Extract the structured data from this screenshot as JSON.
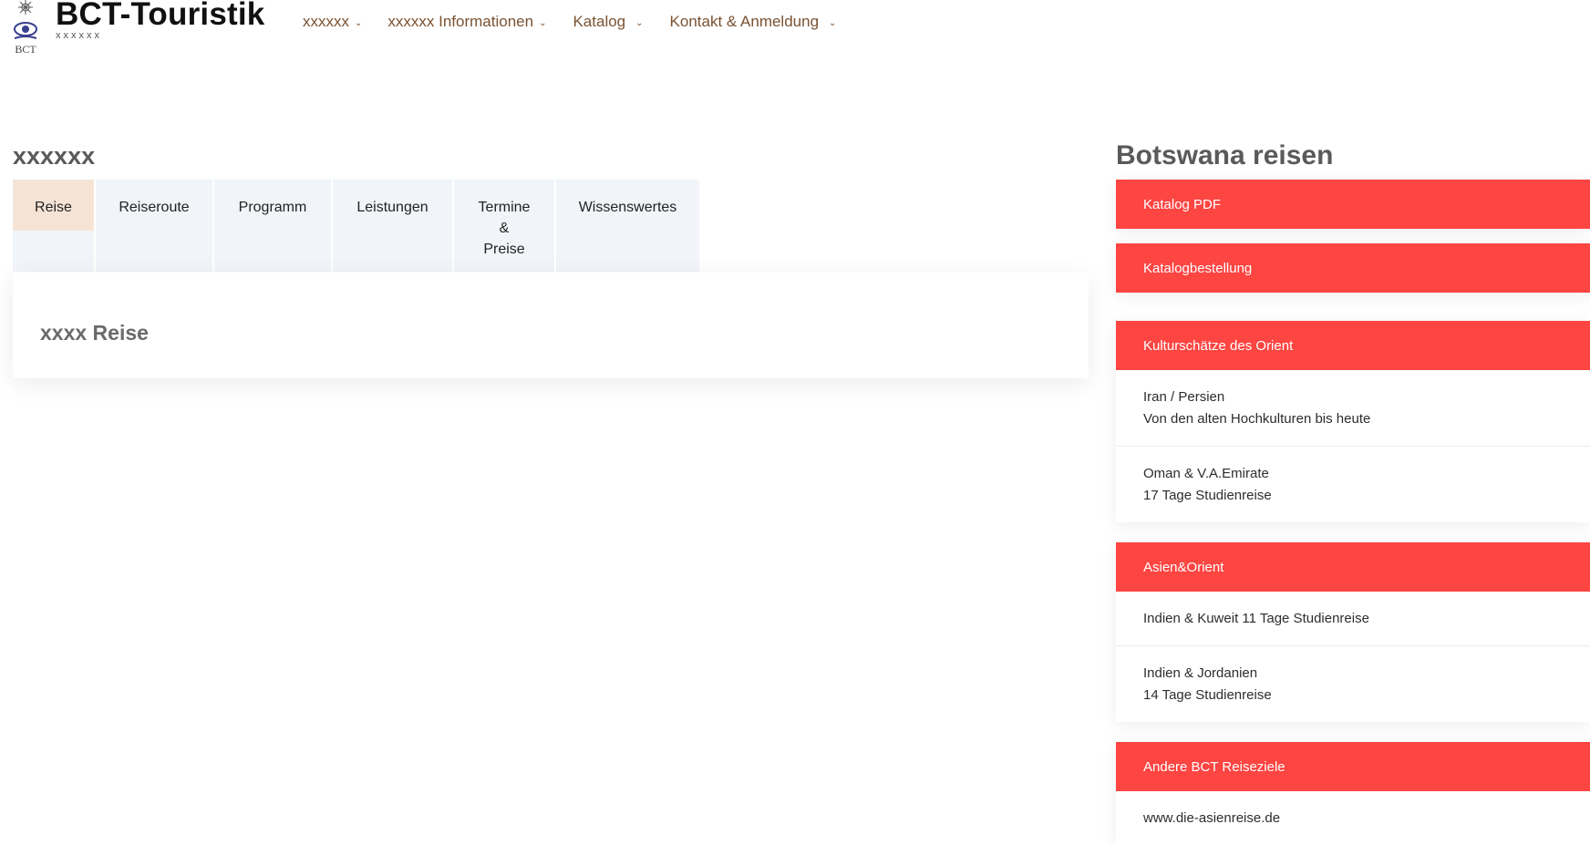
{
  "header": {
    "brand": "BCT-Touristik",
    "tagline": "xxxxxx",
    "logo_text": "BCT",
    "nav": [
      {
        "label": "xxxxxx"
      },
      {
        "label": "xxxxxx Informationen"
      },
      {
        "label": "Katalog"
      },
      {
        "label": "Kontakt & Anmeldung"
      }
    ]
  },
  "main": {
    "title": "xxxxxx",
    "tabs": [
      {
        "label": "Reise"
      },
      {
        "label": "Reiseroute"
      },
      {
        "label": "Programm"
      },
      {
        "label": "Leistungen"
      },
      {
        "label": "Termine\n&\nPreise"
      },
      {
        "label": "Wissenswertes"
      }
    ],
    "content_heading": "xxxx Reise"
  },
  "sidebar": {
    "title": "Botswana reisen",
    "blocks": [
      {
        "head": "Katalog PDF",
        "rows": []
      },
      {
        "head": "Katalogbestellung",
        "rows": []
      },
      {
        "head": "Kulturschätze des Orient",
        "rows": [
          {
            "l1": "Iran / Persien",
            "l2": "Von den alten Hochkulturen bis heute"
          },
          {
            "l1": "Oman & V.A.Emirate",
            "l2": "17  Tage Studienreise"
          }
        ]
      },
      {
        "head": "Asien&Orient",
        "rows": [
          {
            "l1": "Indien & Kuweit 11 Tage Studienreise",
            "l2": ""
          },
          {
            "l1": "Indien & Jordanien",
            "l2": "14  Tage Studienreise"
          }
        ]
      },
      {
        "head": "Andere BCT Reiseziele",
        "rows": [
          {
            "l1": "www.die-asienreise.de",
            "l2": ""
          }
        ]
      }
    ]
  },
  "colors": {
    "accent_red": "#fd4542",
    "nav_brown": "#7a5232",
    "active_tab": "#f5e4d6",
    "tab_bg": "#f1f4f8"
  }
}
